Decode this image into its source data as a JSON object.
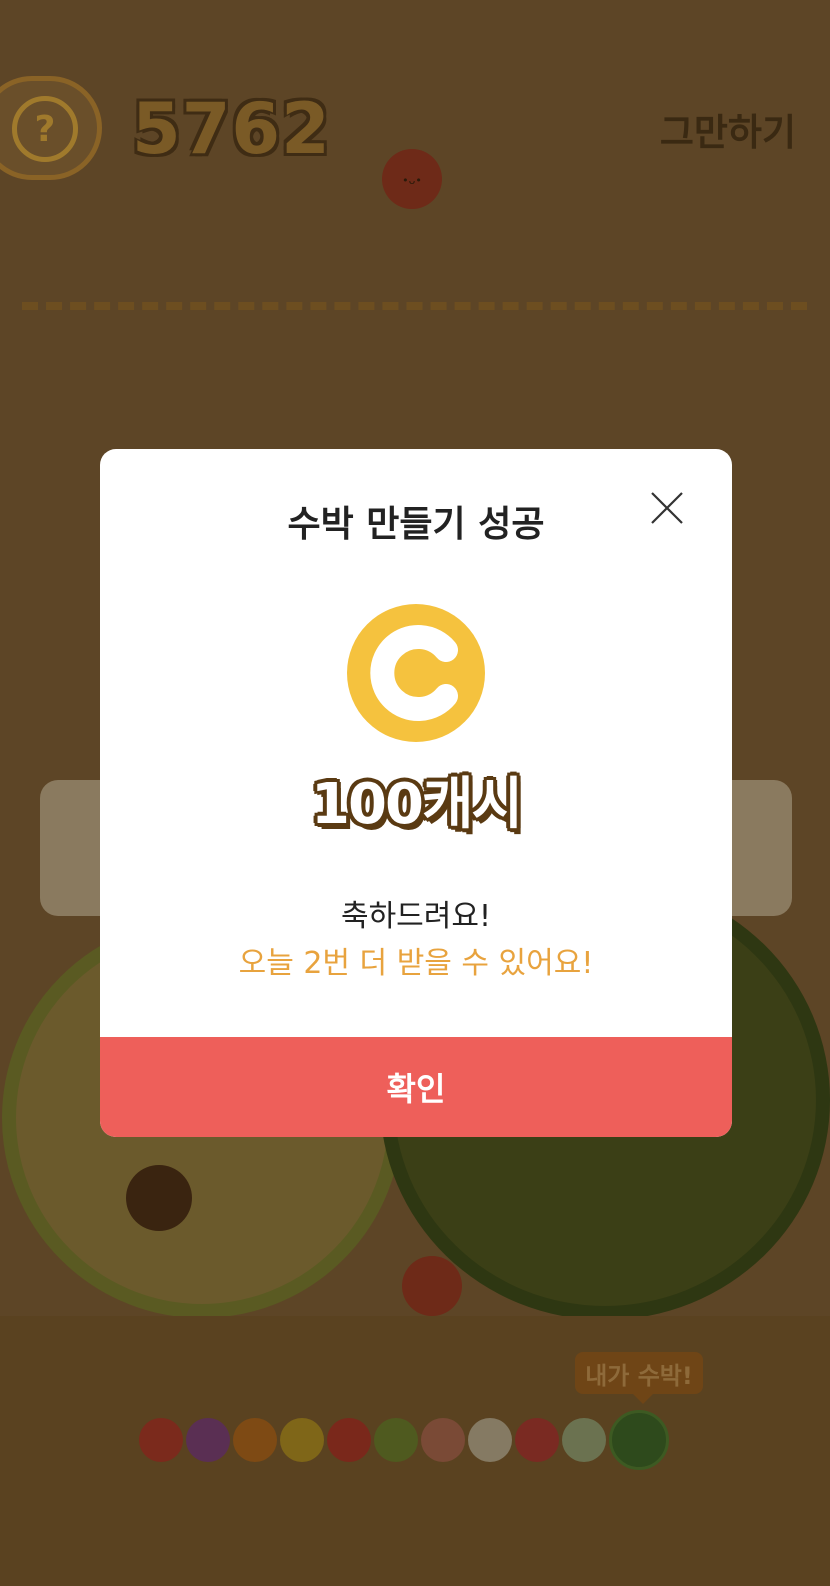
{
  "game": {
    "score": "5762",
    "help_glyph": "?",
    "quit_label": "그만하기",
    "fruit_face": "•ᴗ•",
    "badge_label": "내가 수박!",
    "fruit_sequence": [
      {
        "name": "cherry",
        "color": "#7b2a1c"
      },
      {
        "name": "grape",
        "color": "#5a2f53"
      },
      {
        "name": "tangerine",
        "color": "#7e4a14"
      },
      {
        "name": "lemon",
        "color": "#7f6618"
      },
      {
        "name": "tomato",
        "color": "#7a281b"
      },
      {
        "name": "kiwi",
        "color": "#4f5a1f"
      },
      {
        "name": "peach",
        "color": "#7a4a36"
      },
      {
        "name": "coconut",
        "color": "#857a63"
      },
      {
        "name": "strawberry",
        "color": "#7a2a22"
      },
      {
        "name": "melon",
        "color": "#6b7250"
      },
      {
        "name": "watermelon",
        "color": "#2e4a1c"
      }
    ]
  },
  "dialog": {
    "title": "수박 만들기 성공",
    "coin_icon": "coin-c-icon",
    "reward": "100캐시",
    "message": "축하드려요!",
    "subtext": "오늘 2번 더 받을 수 있어요!",
    "confirm_label": "확인"
  },
  "colors": {
    "confirm": "#ee5f5a",
    "highlight": "#e8a33e",
    "coin": "#f5c23e"
  }
}
